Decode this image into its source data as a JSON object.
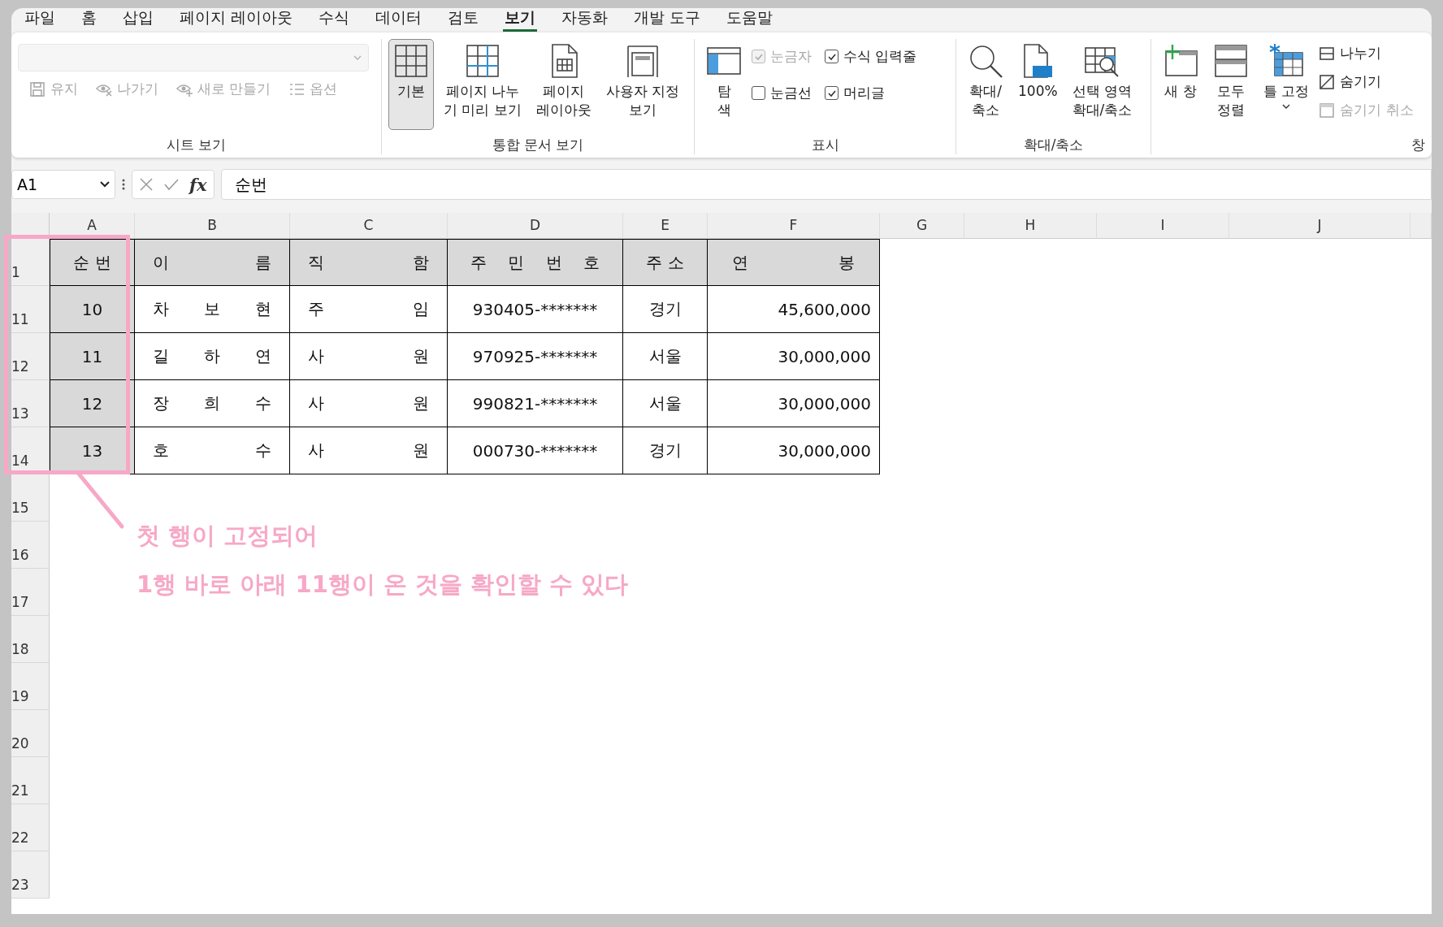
{
  "menu_tabs": [
    {
      "label": "파일",
      "selected": false
    },
    {
      "label": "홈",
      "selected": false
    },
    {
      "label": "삽입",
      "selected": false
    },
    {
      "label": "페이지 레이아웃",
      "selected": false
    },
    {
      "label": "수식",
      "selected": false
    },
    {
      "label": "데이터",
      "selected": false
    },
    {
      "label": "검토",
      "selected": false
    },
    {
      "label": "보기",
      "selected": true
    },
    {
      "label": "자동화",
      "selected": false
    },
    {
      "label": "개발 도구",
      "selected": false
    },
    {
      "label": "도움말",
      "selected": false
    }
  ],
  "ribbon": {
    "groups": [
      {
        "label": "시트 보기",
        "kind": "sheet_view",
        "dropdown": {
          "disabled": true
        },
        "items": [
          {
            "kind": "small",
            "label": "유지",
            "disabled": true
          },
          {
            "kind": "small",
            "label": "나가기",
            "disabled": true
          },
          {
            "kind": "small",
            "label": "새로 만들기",
            "disabled": true
          },
          {
            "kind": "small",
            "label": "옵션",
            "disabled": true
          }
        ]
      },
      {
        "label": "통합 문서 보기",
        "kind": "buttons",
        "items": [
          {
            "kind": "large",
            "label": "기본",
            "selected": true
          },
          {
            "kind": "large",
            "label": "페이지 나누\n기 미리 보기",
            "selected": false
          },
          {
            "kind": "large",
            "label": "페이지\n레이아웃",
            "selected": false
          },
          {
            "kind": "large",
            "label": "사용자 지정\n보기",
            "selected": false
          }
        ]
      },
      {
        "label": "표시",
        "kind": "show",
        "items": [
          {
            "kind": "large",
            "label": "탐\n색"
          },
          {
            "kind": "checkbox",
            "label": "눈금자",
            "checked": true,
            "disabled": true
          },
          {
            "kind": "checkbox",
            "label": "눈금선",
            "checked": false,
            "disabled": false
          },
          {
            "kind": "checkbox",
            "label": "수식 입력줄",
            "checked": true,
            "disabled": false
          },
          {
            "kind": "checkbox",
            "label": "머리글",
            "checked": true,
            "disabled": false
          }
        ]
      },
      {
        "label": "확대/축소",
        "kind": "buttons",
        "items": [
          {
            "kind": "large",
            "label": "확대/\n축소"
          },
          {
            "kind": "large",
            "label": "100%"
          },
          {
            "kind": "large",
            "label": "선택 영역\n확대/축소"
          }
        ]
      },
      {
        "label": "창",
        "kind": "buttons",
        "items": [
          {
            "kind": "large",
            "label": "새 창"
          },
          {
            "kind": "large",
            "label": "모두\n정렬"
          },
          {
            "kind": "large_menu",
            "label": "틀 고정"
          },
          {
            "kind": "small",
            "label": "나누기",
            "disabled": false
          },
          {
            "kind": "small",
            "label": "숨기기",
            "disabled": false
          },
          {
            "kind": "small",
            "label": "숨기기 취소",
            "disabled": true
          }
        ]
      }
    ]
  },
  "formula_bar": {
    "name_box": "A1",
    "function_label": "fx",
    "formula": "순번"
  },
  "sheet": {
    "columns": [
      "A",
      "B",
      "C",
      "D",
      "E",
      "F",
      "G",
      "H",
      "I",
      "J"
    ],
    "rows": [
      {
        "header": "1",
        "cells": [
          "순 번",
          "이 름",
          "직 함",
          "주 민 번 호",
          "주 소",
          "연 봉"
        ]
      },
      {
        "header": "11",
        "cells": [
          "10",
          "차 보 현",
          "주 임",
          "930405-*******",
          "경기",
          "45,600,000"
        ]
      },
      {
        "header": "12",
        "cells": [
          "11",
          "길 하 연",
          "사 원",
          "970925-*******",
          "서울",
          "30,000,000"
        ]
      },
      {
        "header": "13",
        "cells": [
          "12",
          "장 희 수",
          "사 원",
          "990821-*******",
          "서울",
          "30,000,000"
        ]
      },
      {
        "header": "14",
        "cells": [
          "13",
          "호 수",
          "사 원",
          "000730-*******",
          "경기",
          "30,000,000"
        ]
      },
      {
        "header": "15"
      },
      {
        "header": "16"
      },
      {
        "header": "17"
      },
      {
        "header": "18"
      },
      {
        "header": "19"
      },
      {
        "header": "20"
      },
      {
        "header": "21"
      },
      {
        "header": "22"
      },
      {
        "header": "23"
      }
    ]
  },
  "annotation": {
    "lines": [
      "첫 행이 고정되어",
      "1행 바로 아래 11행이 온 것을 확인할 수 있다"
    ]
  }
}
